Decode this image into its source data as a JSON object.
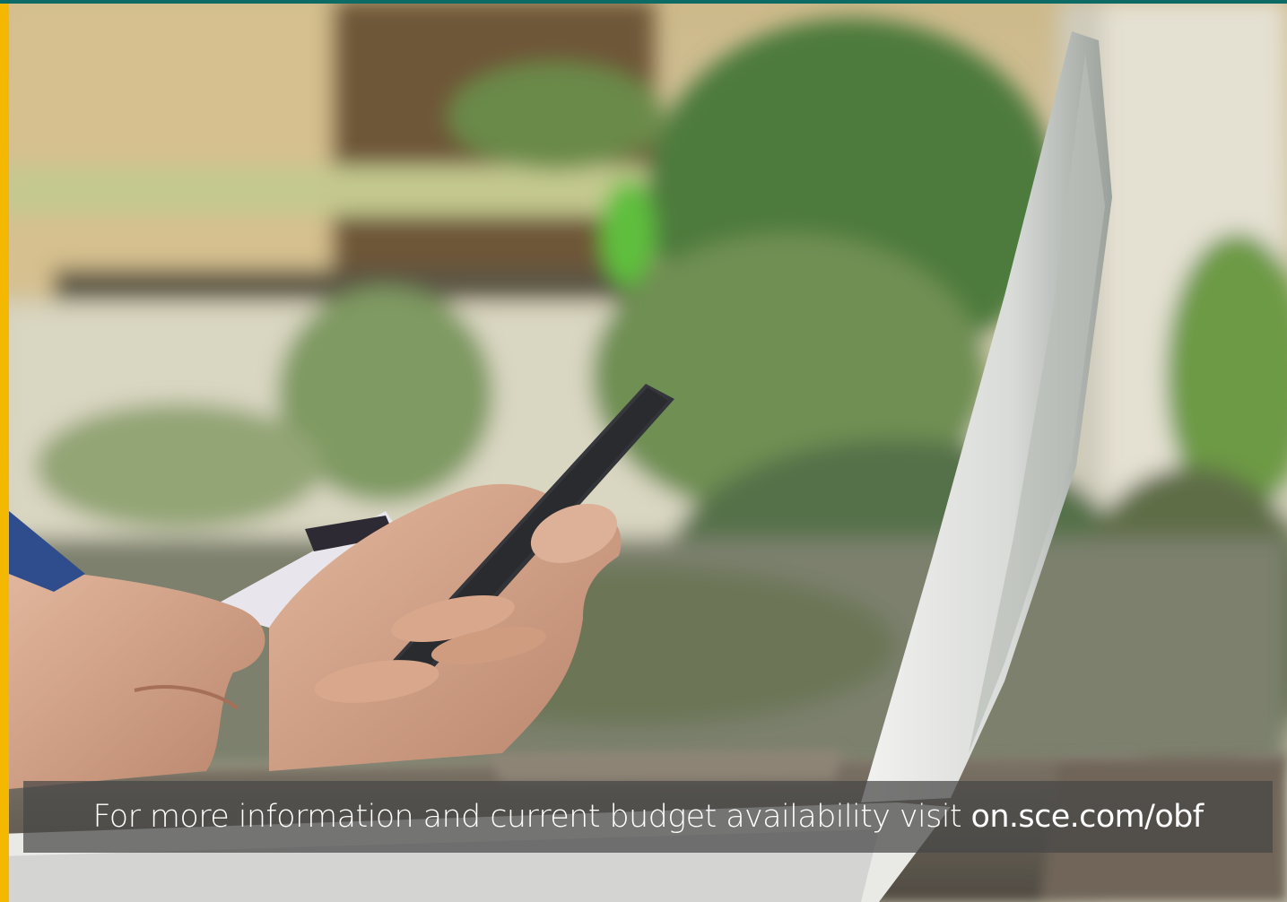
{
  "caption": {
    "text": "For more information and current budget availability visit",
    "link": "on.sce.com/obf"
  },
  "colors": {
    "accent_left": "#f5b800",
    "accent_top": "#0d6b66",
    "caption_band": "#464646"
  },
  "photo": {
    "subject": "hands-holding-smartphone-and-credit-card-beside-laptop"
  }
}
